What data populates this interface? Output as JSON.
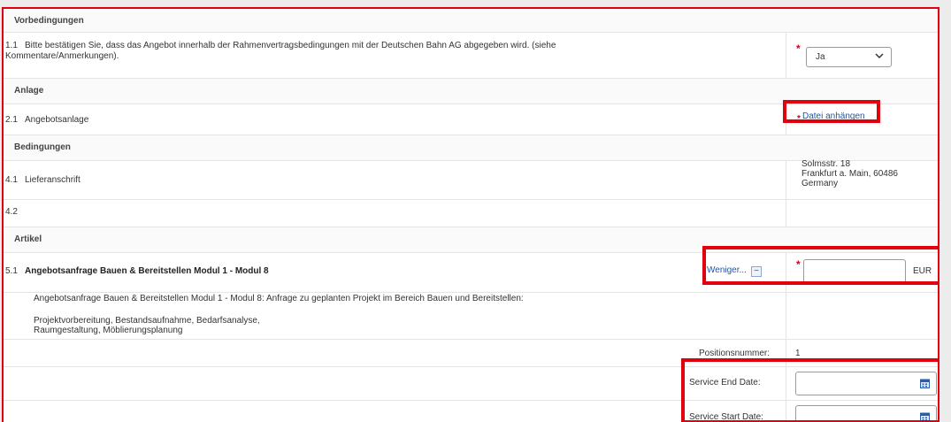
{
  "sections": {
    "vorbedingungen": "Vorbedingungen",
    "anlage": "Anlage",
    "bedingungen": "Bedingungen",
    "artikel": "Artikel"
  },
  "q11": {
    "number": "1.1",
    "text_line1": "Bitte bestätigen Sie, dass das Angebot innerhalb der Rahmenvertragsbedingungen mit der Deutschen Bahn AG abgegeben wird. (siehe",
    "text_line2": "Kommentare/Anmerkungen).",
    "required_marker": "*",
    "select_value": "Ja"
  },
  "q21": {
    "number": "2.1",
    "label": "Angebotsanlage",
    "required_marker": "*",
    "attach_link": "Datei anhängen"
  },
  "q41": {
    "number": "4.1",
    "label": "Lieferanschrift",
    "address_line1": "Solmsstr. 18",
    "address_line2": "Frankfurt a. Main,   60486",
    "address_line3": "Germany"
  },
  "q42": {
    "number": "4.2"
  },
  "item51": {
    "number": "5.1",
    "title": "Angebotsanfrage Bauen & Bereitstellen Modul 1 - Modul 8",
    "less_link": "Weniger...",
    "less_icon": "−",
    "required_marker": "*",
    "price_value": "",
    "currency": "EUR",
    "desc_line1": "Angebotsanfrage Bauen & Bereitstellen Modul 1 - Modul 8: Anfrage zu geplanten Projekt im Bereich Bauen und Bereitstellen:",
    "desc_line2": "Projektvorbereitung, Bestandsaufnahme, Bedarfsanalyse,",
    "desc_line3": "Raumgestaltung, Möblierungsplanung",
    "position_label": "Positionsnummer:",
    "position_value": "1",
    "service_end_label": "Service End Date:",
    "service_end_value": "",
    "service_start_label": "Service Start Date:",
    "service_start_value": ""
  },
  "icons": {
    "select_chevron": "chevron-down-icon",
    "calendar": "calendar-icon"
  },
  "colors": {
    "highlight": "#e2000f",
    "link": "#2155a6",
    "required": "#d0021b"
  }
}
